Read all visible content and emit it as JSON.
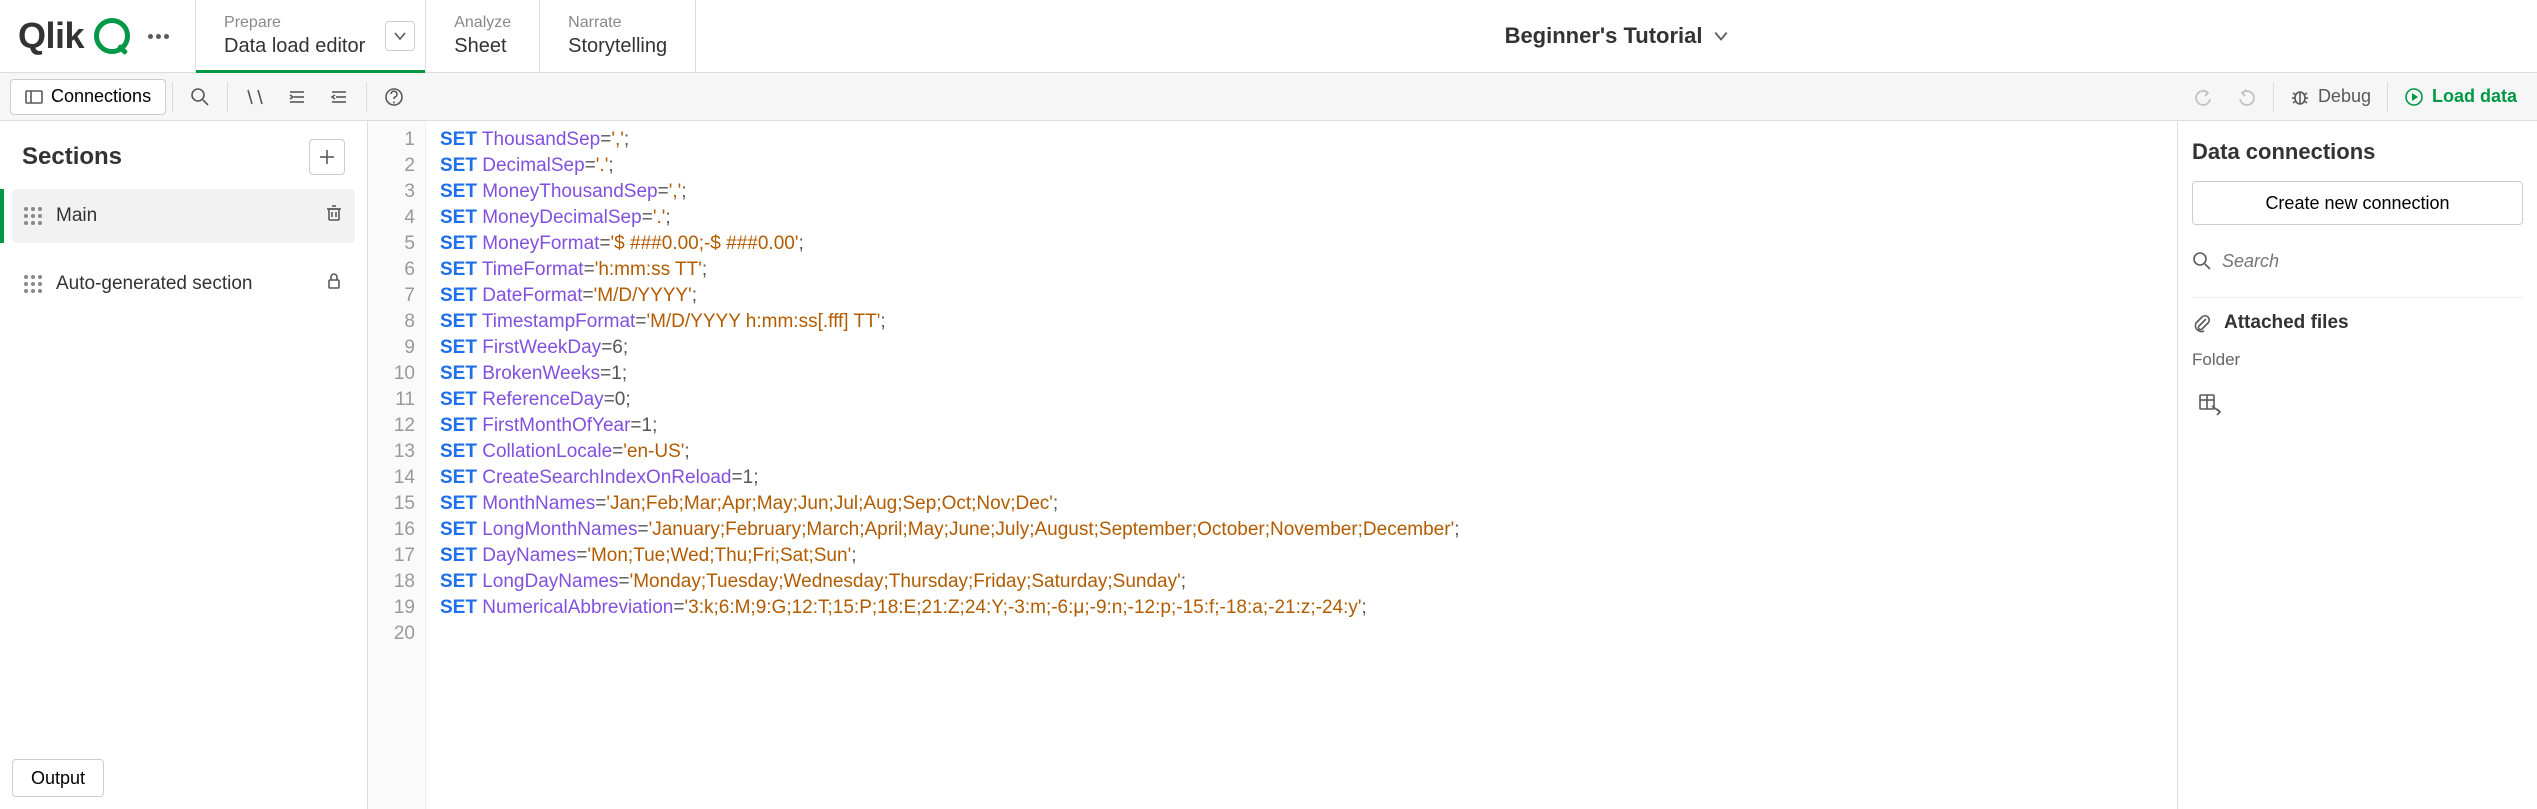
{
  "header": {
    "logo_text": "Qlik",
    "tabs": [
      {
        "small": "Prepare",
        "big": "Data load editor",
        "active": true,
        "chevron": true
      },
      {
        "small": "Analyze",
        "big": "Sheet"
      },
      {
        "small": "Narrate",
        "big": "Storytelling"
      }
    ],
    "app_title": "Beginner's Tutorial"
  },
  "toolbar": {
    "connections_label": "Connections",
    "debug_label": "Debug",
    "load_label": "Load data"
  },
  "sections": {
    "title": "Sections",
    "items": [
      {
        "label": "Main",
        "active": true,
        "action_icon": "trash"
      },
      {
        "label": "Auto-generated section",
        "active": false,
        "action_icon": "lock"
      }
    ]
  },
  "editor": {
    "lines": [
      {
        "kw": "SET",
        "var": "ThousandSep",
        "eq": "=",
        "str": "','",
        "end": ";"
      },
      {
        "kw": "SET",
        "var": "DecimalSep",
        "eq": "=",
        "str": "'.'",
        "end": ";"
      },
      {
        "kw": "SET",
        "var": "MoneyThousandSep",
        "eq": "=",
        "str": "','",
        "end": ";"
      },
      {
        "kw": "SET",
        "var": "MoneyDecimalSep",
        "eq": "=",
        "str": "'.'",
        "end": ";"
      },
      {
        "kw": "SET",
        "var": "MoneyFormat",
        "eq": "=",
        "str": "'$ ###0.00;-$ ###0.00'",
        "end": ";"
      },
      {
        "kw": "SET",
        "var": "TimeFormat",
        "eq": "=",
        "str": "'h:mm:ss TT'",
        "end": ";"
      },
      {
        "kw": "SET",
        "var": "DateFormat",
        "eq": "=",
        "str": "'M/D/YYYY'",
        "end": ";"
      },
      {
        "kw": "SET",
        "var": "TimestampFormat",
        "eq": "=",
        "str": "'M/D/YYYY h:mm:ss[.fff] TT'",
        "end": ";"
      },
      {
        "kw": "SET",
        "var": "FirstWeekDay",
        "eq": "=",
        "num": "6",
        "end": ";"
      },
      {
        "kw": "SET",
        "var": "BrokenWeeks",
        "eq": "=",
        "num": "1",
        "end": ";"
      },
      {
        "kw": "SET",
        "var": "ReferenceDay",
        "eq": "=",
        "num": "0",
        "end": ";"
      },
      {
        "kw": "SET",
        "var": "FirstMonthOfYear",
        "eq": "=",
        "num": "1",
        "end": ";"
      },
      {
        "kw": "SET",
        "var": "CollationLocale",
        "eq": "=",
        "str": "'en-US'",
        "end": ";"
      },
      {
        "kw": "SET",
        "var": "CreateSearchIndexOnReload",
        "eq": "=",
        "num": "1",
        "end": ";"
      },
      {
        "kw": "SET",
        "var": "MonthNames",
        "eq": "=",
        "str": "'Jan;Feb;Mar;Apr;May;Jun;Jul;Aug;Sep;Oct;Nov;Dec'",
        "end": ";"
      },
      {
        "kw": "SET",
        "var": "LongMonthNames",
        "eq": "=",
        "str": "'January;February;March;April;May;June;July;August;September;October;November;December'",
        "end": ";"
      },
      {
        "kw": "SET",
        "var": "DayNames",
        "eq": "=",
        "str": "'Mon;Tue;Wed;Thu;Fri;Sat;Sun'",
        "end": ";"
      },
      {
        "kw": "SET",
        "var": "LongDayNames",
        "eq": "=",
        "str": "'Monday;Tuesday;Wednesday;Thursday;Friday;Saturday;Sunday'",
        "end": ";"
      },
      {
        "kw": "SET",
        "var": "NumericalAbbreviation",
        "eq": "=",
        "str": "'3:k;6:M;9:G;12:T;15:P;18:E;21:Z;24:Y;-3:m;-6:μ;-9:n;-12:p;-15:f;-18:a;-21:z;-24:y'",
        "end": ";"
      }
    ],
    "blank_lines_after": 1
  },
  "right_panel": {
    "title": "Data connections",
    "create_btn": "Create new connection",
    "search_placeholder": "Search",
    "attached_label": "Attached files",
    "folder_label": "Folder"
  },
  "output_btn": "Output"
}
